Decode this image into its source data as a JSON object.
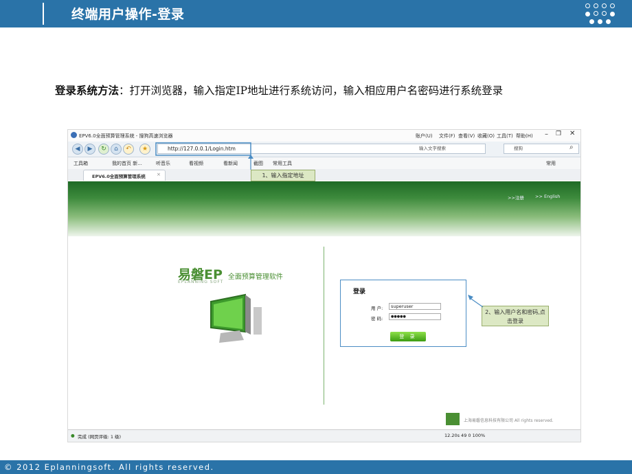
{
  "slide": {
    "title": "终端用户操作-登录",
    "description_bold": "登录系统方法",
    "description_rest": "：打开浏览器，输入指定IP地址进行系统访问，输入相应用户名密码进行系统登录",
    "footer": "© 2012 Eplanningsoft. All rights reserved."
  },
  "browser": {
    "window_title": "EPV6.0全面预算管理系统 - 搜狗高速浏览器",
    "menu": [
      "账户(U)",
      "文件(F)",
      "查看(V)",
      "收藏(O)",
      "工具(T)",
      "帮助(H)"
    ],
    "address": "http://127.0.0.1/Login.htm",
    "address_hint": "输入文字搜索",
    "search_placeholder": "搜狗",
    "bookmarks": [
      "工具箱",
      "我的首页 新...",
      "听音乐",
      "看视频",
      "看新闻",
      "截图",
      "常用工具"
    ],
    "bookmarks_right": "常用",
    "tab_label": "EPV6.0全面预算管理系统",
    "status_left": "完成 (网页评级: 1 级)",
    "status_right": "12.20s   49   0   100%"
  },
  "page": {
    "nav_links": [
      ">>注册",
      ">> English"
    ],
    "logo_text": "易磐EP",
    "logo_sub": "全面预算管理软件",
    "logo_en": "EPLANNING SOFT",
    "login_heading": "登录",
    "user_label": "用 户:",
    "user_value": "superuser",
    "pwd_label": "密 码:",
    "pwd_value": "●●●●●",
    "login_button": "登 录",
    "company": "上海易磐信息科技有限公司  All rights reserved."
  },
  "callouts": {
    "step1": "1、输入指定地址",
    "step2": "2、输入用户名和密码,点击登录"
  },
  "colors": {
    "header": "#2a73a8",
    "accent_green": "#4a8f33",
    "callout_bg": "#dce8c4"
  }
}
